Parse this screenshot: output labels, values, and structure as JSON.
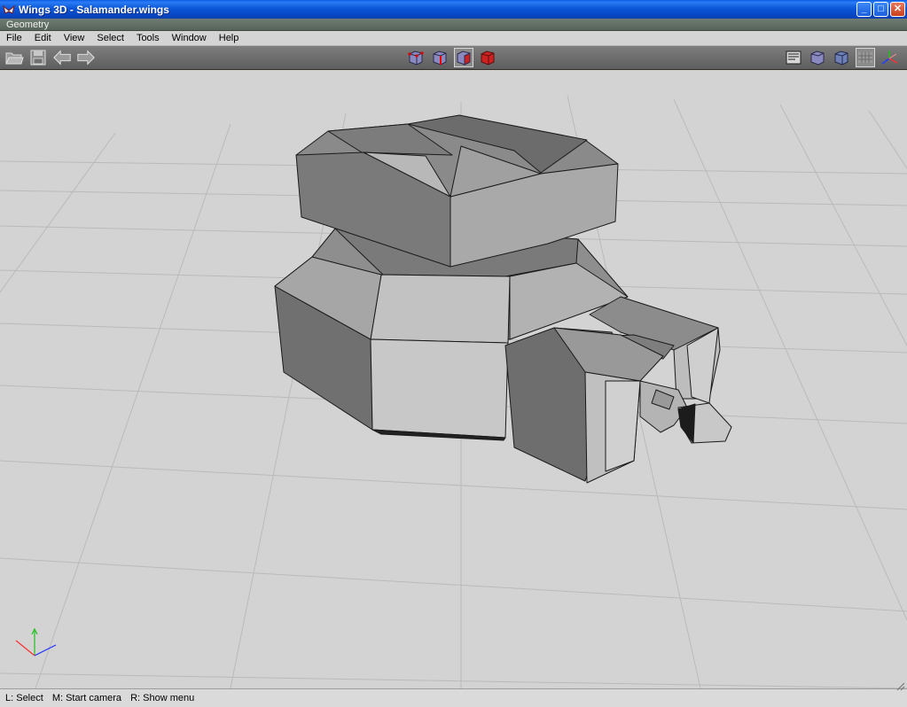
{
  "window": {
    "title": "Wings 3D - Salamander.wings",
    "controls": {
      "minimize": "_",
      "maximize": "□",
      "close": "✕"
    }
  },
  "geometry_bar": {
    "label": "Geometry"
  },
  "menu": {
    "items": [
      {
        "label": "File"
      },
      {
        "label": "Edit"
      },
      {
        "label": "View"
      },
      {
        "label": "Select"
      },
      {
        "label": "Tools"
      },
      {
        "label": "Window"
      },
      {
        "label": "Help"
      }
    ]
  },
  "toolbar": {
    "left_icons": [
      "folder-open-icon",
      "save-disk-icon",
      "undo-arrow-icon",
      "redo-arrow-icon"
    ],
    "selection_modes": [
      "vertex-mode-icon",
      "edge-mode-icon",
      "face-mode-icon",
      "body-mode-icon"
    ],
    "active_selection_mode": "face-mode-icon",
    "right_icons": [
      "wireframe-toggle-icon",
      "smooth-preview-icon",
      "perspective-icon",
      "ground-plane-icon",
      "axes-icon"
    ],
    "accent_red": "#cc2222"
  },
  "status_bar": {
    "hints": [
      {
        "text": "L: Select"
      },
      {
        "text": "M: Start camera"
      },
      {
        "text": "R: Show menu"
      }
    ]
  }
}
